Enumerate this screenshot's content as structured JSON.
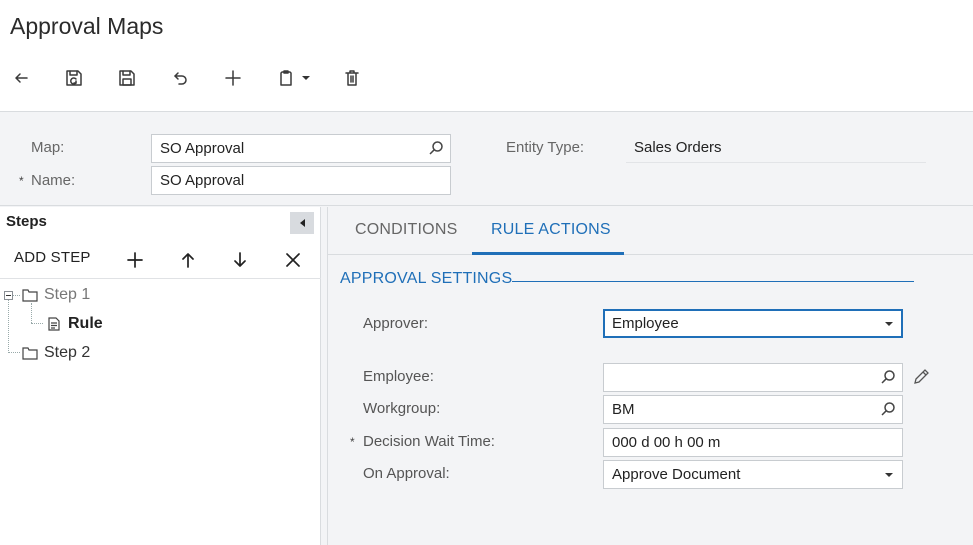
{
  "page": {
    "title": "Approval Maps"
  },
  "toolbar": {
    "buttons": [
      {
        "name": "back-button",
        "icon": "back-arrow-icon"
      },
      {
        "name": "save-close-button",
        "icon": "save-close-icon"
      },
      {
        "name": "save-button",
        "icon": "save-icon"
      },
      {
        "name": "undo-button",
        "icon": "undo-icon"
      },
      {
        "name": "add-button",
        "icon": "plus-icon"
      },
      {
        "name": "copy-paste-button",
        "icon": "clipboard-icon"
      },
      {
        "name": "delete-button",
        "icon": "trash-icon"
      }
    ]
  },
  "header": {
    "map_label": "Map:",
    "map_value": "SO Approval",
    "name_label": "Name:",
    "name_value": "SO Approval",
    "required_star": "*",
    "entity_type_label": "Entity Type:",
    "entity_type_value": "Sales Orders"
  },
  "steps_panel": {
    "title": "Steps",
    "add_step_label": "ADD STEP",
    "tree": [
      {
        "label": "Step 1",
        "type": "folder",
        "expanded": true
      },
      {
        "label": "Rule",
        "type": "document",
        "selected": true
      },
      {
        "label": "Step 2",
        "type": "folder"
      }
    ]
  },
  "tabs": [
    {
      "label": "CONDITIONS",
      "active": false
    },
    {
      "label": "RULE ACTIONS",
      "active": true
    }
  ],
  "approval_settings": {
    "section_title": "APPROVAL SETTINGS",
    "approver_label": "Approver:",
    "approver_value": "Employee",
    "employee_label": "Employee:",
    "employee_value": "",
    "workgroup_label": "Workgroup:",
    "workgroup_value": "BM",
    "decision_wait_label": "Decision Wait Time:",
    "decision_wait_value": "000 d 00 h 00 m",
    "on_approval_label": "On Approval:",
    "on_approval_value": "Approve Document",
    "required_star": "*"
  },
  "colors": {
    "accent": "#1f6fb8",
    "background": "#f3f4f6",
    "panel": "#ffffff"
  }
}
